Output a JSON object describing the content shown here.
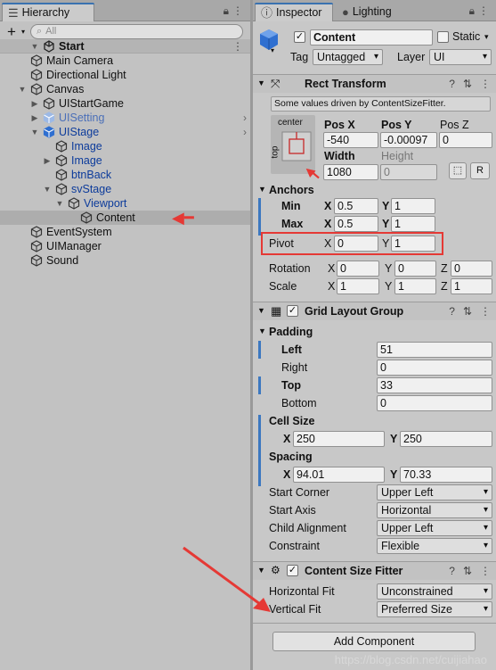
{
  "hierarchy": {
    "tab": "Hierarchy",
    "search_placeholder": "All",
    "scene": "Start",
    "items": [
      {
        "label": "Main Camera"
      },
      {
        "label": "Directional Light"
      },
      {
        "label": "Canvas"
      },
      {
        "label": "UIStartGame"
      },
      {
        "label": "UISetting"
      },
      {
        "label": "UIStage"
      },
      {
        "label": "Image"
      },
      {
        "label": "Image"
      },
      {
        "label": "btnBack"
      },
      {
        "label": "svStage"
      },
      {
        "label": "Viewport"
      },
      {
        "label": "Content"
      },
      {
        "label": "EventSystem"
      },
      {
        "label": "UIManager"
      },
      {
        "label": "Sound"
      }
    ]
  },
  "inspector": {
    "tabs": [
      "Inspector",
      "Lighting"
    ],
    "object_name": "Content",
    "static_label": "Static",
    "tag_label": "Tag",
    "tag_value": "Untagged",
    "layer_label": "Layer",
    "layer_value": "UI",
    "rect": {
      "title": "Rect Transform",
      "note": "Some values driven by ContentSizeFitter.",
      "anchor_preset_h": "center",
      "anchor_preset_v": "top",
      "posx_label": "Pos X",
      "posy_label": "Pos Y",
      "posz_label": "Pos Z",
      "posx": "-540",
      "posy": "-0.00097",
      "posz": "0",
      "width_label": "Width",
      "height_label": "Height",
      "width": "1080",
      "height": "0",
      "r_button": "R",
      "anchors_label": "Anchors",
      "min_label": "Min",
      "max_label": "Max",
      "min_x": "0.5",
      "min_y": "1",
      "max_x": "0.5",
      "max_y": "1",
      "pivot_label": "Pivot",
      "pivot_x": "0",
      "pivot_y": "1",
      "rotation_label": "Rotation",
      "rot_x": "0",
      "rot_y": "0",
      "rot_z": "0",
      "scale_label": "Scale",
      "scale_x": "1",
      "scale_y": "1",
      "scale_z": "1",
      "x": "X",
      "y": "Y",
      "z": "Z"
    },
    "grid": {
      "title": "Grid Layout Group",
      "padding_label": "Padding",
      "left_label": "Left",
      "right_label": "Right",
      "top_label": "Top",
      "bottom_label": "Bottom",
      "left": "51",
      "right": "0",
      "top": "33",
      "bottom": "0",
      "cell_label": "Cell Size",
      "cell_x": "250",
      "cell_y": "250",
      "spacing_label": "Spacing",
      "spacing_x": "94.01",
      "spacing_y": "70.33",
      "start_corner_label": "Start Corner",
      "start_corner": "Upper Left",
      "start_axis_label": "Start Axis",
      "start_axis": "Horizontal",
      "child_align_label": "Child Alignment",
      "child_align": "Upper Left",
      "constraint_label": "Constraint",
      "constraint": "Flexible"
    },
    "fitter": {
      "title": "Content Size Fitter",
      "hfit_label": "Horizontal Fit",
      "hfit": "Unconstrained",
      "vfit_label": "Vertical Fit",
      "vfit": "Preferred Size"
    },
    "add_component": "Add Component"
  },
  "watermark": "https://blog.csdn.net/cuijiahao",
  "accent": "#e53935"
}
